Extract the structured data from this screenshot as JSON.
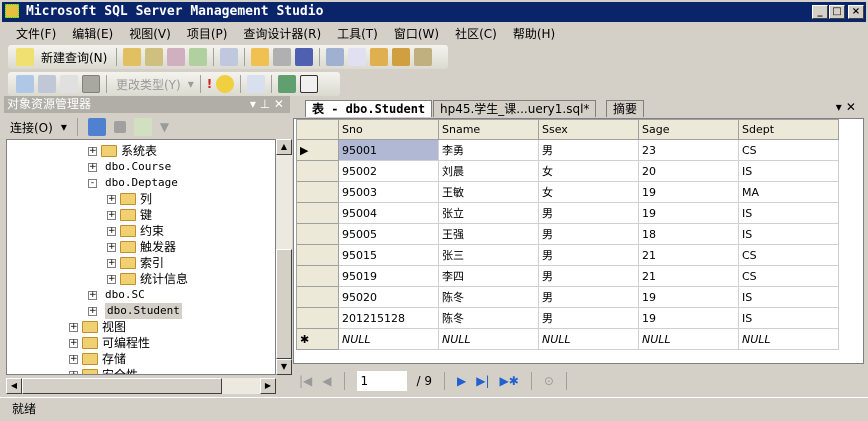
{
  "window": {
    "title": "Microsoft SQL Server Management Studio"
  },
  "menu": [
    "文件(F)",
    "编辑(E)",
    "视图(V)",
    "项目(P)",
    "查询设计器(R)",
    "工具(T)",
    "窗口(W)",
    "社区(C)",
    "帮助(H)"
  ],
  "toolbar1": {
    "new_query": "新建查询(N)"
  },
  "toolbar2": {
    "change_type": "更改类型(Y)"
  },
  "object_explorer": {
    "title": "对象资源管理器",
    "connect": "连接(O)",
    "nodes": [
      {
        "label": "系统表",
        "level": 3,
        "kind": "folder",
        "exp": "+"
      },
      {
        "label": "dbo.Course",
        "level": 3,
        "kind": "table",
        "exp": "+"
      },
      {
        "label": "dbo.Deptage",
        "level": 3,
        "kind": "table",
        "exp": "-"
      },
      {
        "label": "列",
        "level": 4,
        "kind": "folder",
        "exp": "+"
      },
      {
        "label": "键",
        "level": 4,
        "kind": "folder",
        "exp": "+"
      },
      {
        "label": "约束",
        "level": 4,
        "kind": "folder",
        "exp": "+"
      },
      {
        "label": "触发器",
        "level": 4,
        "kind": "folder",
        "exp": "+"
      },
      {
        "label": "索引",
        "level": 4,
        "kind": "folder",
        "exp": "+"
      },
      {
        "label": "统计信息",
        "level": 4,
        "kind": "folder",
        "exp": "+"
      },
      {
        "label": "dbo.SC",
        "level": 3,
        "kind": "table",
        "exp": "+"
      },
      {
        "label": "dbo.Student",
        "level": 3,
        "kind": "table",
        "exp": "+",
        "selected": true
      },
      {
        "label": "视图",
        "level": 2,
        "kind": "folder",
        "exp": "+"
      },
      {
        "label": "可编程性",
        "level": 2,
        "kind": "folder",
        "exp": "+"
      },
      {
        "label": "存储",
        "level": 2,
        "kind": "folder",
        "exp": "+"
      },
      {
        "label": "安全性",
        "level": 2,
        "kind": "folder",
        "exp": "+"
      }
    ]
  },
  "tabs": [
    {
      "label": "表 - dbo.Student",
      "active": true
    },
    {
      "label": "hp45.学生_课...uery1.sql*"
    },
    {
      "label": "摘要"
    }
  ],
  "grid": {
    "columns": [
      "Sno",
      "Sname",
      "Ssex",
      "Sage",
      "Sdept"
    ],
    "rows": [
      [
        "95001",
        "李勇",
        "男",
        "23",
        "CS"
      ],
      [
        "95002",
        "刘晨",
        "女",
        "20",
        "IS"
      ],
      [
        "95003",
        "王敏",
        "女",
        "19",
        "MA"
      ],
      [
        "95004",
        "张立",
        "男",
        "19",
        "IS"
      ],
      [
        "95005",
        "王强",
        "男",
        "18",
        "IS"
      ],
      [
        "95015",
        "张三",
        "男",
        "21",
        "CS"
      ],
      [
        "95019",
        "李四",
        "男",
        "21",
        "CS"
      ],
      [
        "95020",
        "陈冬",
        "男",
        "19",
        "IS"
      ],
      [
        "201215128",
        "陈冬",
        "男",
        "19",
        "IS"
      ]
    ],
    "new_row": [
      "NULL",
      "NULL",
      "NULL",
      "NULL",
      "NULL"
    ],
    "current_marker": "▶",
    "new_marker": "✱"
  },
  "pager": {
    "current": "1",
    "total": "/ 9"
  },
  "status": "就绪"
}
